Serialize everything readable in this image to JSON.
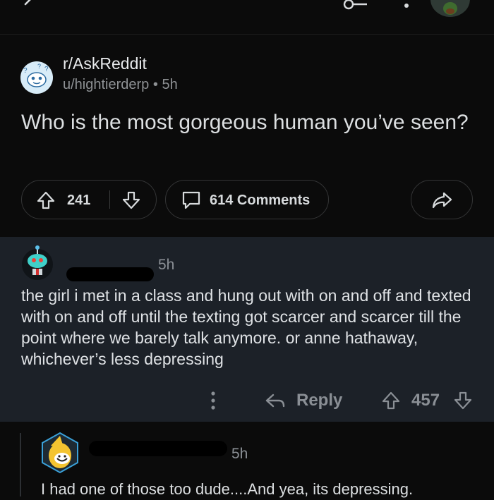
{
  "post": {
    "subreddit": "r/AskReddit",
    "author": "u/hightierderp",
    "separator": "•",
    "age": "5h",
    "title": "Who is the most gorgeous human you’ve seen?",
    "upvotes": "241",
    "comments_label": "614 Comments"
  },
  "comments": [
    {
      "age": "5h",
      "body": "the girl i met in a class and hung out with on and off and texted with on and off until the texting got scarcer and scarcer till the point where we barely talk anymore. or anne hathaway, whichever’s less depressing",
      "reply_label": "Reply",
      "score": "457"
    },
    {
      "age": "5h",
      "body": "I had one of those too dude....And yea, its depressing."
    }
  ],
  "icons": {
    "back": "back-arrow-icon",
    "sort": "sort-icon",
    "more": "more-vertical-icon",
    "upvote": "upvote-arrow-icon",
    "downvote": "downvote-arrow-icon",
    "comment": "comment-bubble-icon",
    "share": "share-arrow-icon",
    "reply": "reply-arrow-icon"
  },
  "colors": {
    "background": "#0b0b0b",
    "comment_background": "#1c2128",
    "text": "#d7dadc",
    "muted": "#8b9096"
  }
}
